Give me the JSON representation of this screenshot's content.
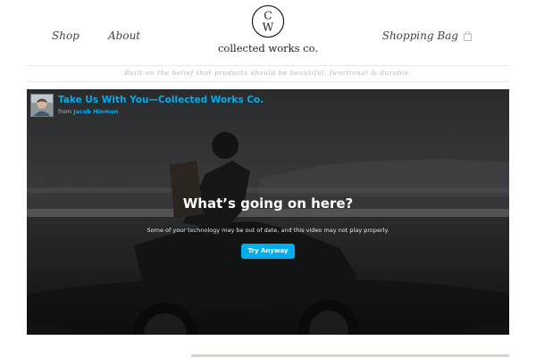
{
  "nav": {
    "shop": "Shop",
    "about": "About",
    "bag": "Shopping Bag",
    "bag_icon": "shopping-bag-icon"
  },
  "logo": {
    "monogram_letters": "CW",
    "wordmark": "collected works co."
  },
  "tagline": "Built on the belief that products should be beautiful, functional & durable.",
  "video": {
    "title": "Take Us With You—Collected Works Co.",
    "byline_prefix": "from",
    "author": "Jacob Hinmon",
    "message_title": "What’s going on here?",
    "message_body": "Some of your technology may be out of date, and this video may not play properly.",
    "button_label": "Try Anyway",
    "accent_color": "#00adef"
  }
}
